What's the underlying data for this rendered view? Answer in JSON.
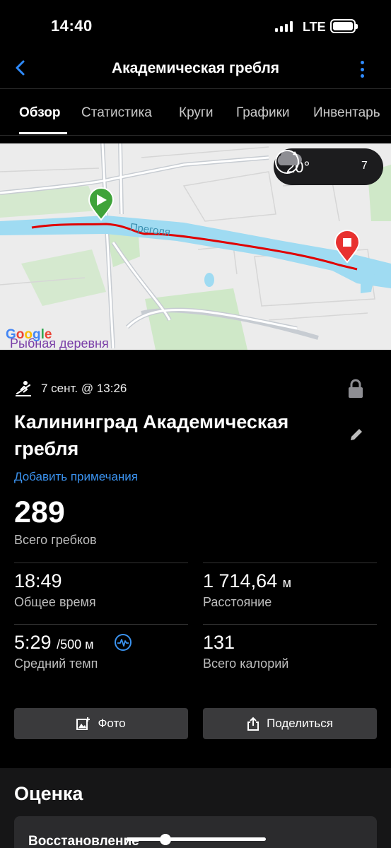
{
  "status_bar": {
    "time": "14:40",
    "network": "LTE",
    "battery_icon": "battery-full-icon"
  },
  "header": {
    "title": "Академическая гребля",
    "back_icon": "chevron-left-icon",
    "menu_icon": "more-vertical-icon",
    "accent_color": "#2f8bff"
  },
  "tabs": [
    {
      "label": "Обзор",
      "active": true
    },
    {
      "label": "Статистика",
      "active": false
    },
    {
      "label": "Круги",
      "active": false
    },
    {
      "label": "Графики",
      "active": false
    },
    {
      "label": "Инвентарь",
      "active": false
    }
  ],
  "map": {
    "river_label": "Преголя",
    "place_label": "Рыбная деревня",
    "google_logo": "Google",
    "weather": {
      "temperature": "20°",
      "condition_icon": "cloud-icon",
      "wind_value": "7",
      "wind_icon": "wind-direction-icon"
    },
    "start_icon": "start-play-marker-icon",
    "end_icon": "stop-marker-icon",
    "track_color": "#e00000"
  },
  "activity": {
    "type_icon": "rowing-icon",
    "date": "7 сент. @ 13:26",
    "name": "Калининград Академическая гребля",
    "add_notes": "Добавить примечания",
    "total_strokes": {
      "value": "289",
      "label": "Всего гребков"
    }
  },
  "stats": [
    {
      "value": "18:49",
      "unit": "",
      "label": "Общее время"
    },
    {
      "value": "1 714,64",
      "unit": "м",
      "label": "Расстояние"
    },
    {
      "value": "5:29",
      "unit": "/500 м",
      "label": "Средний темп"
    },
    {
      "value": "131",
      "unit": "",
      "label": "Всего калорий"
    }
  ],
  "actions": {
    "photo": "Фото",
    "share": "Поделиться"
  },
  "rating": {
    "title": "Оценка",
    "recovery_label": "Восстановление"
  }
}
